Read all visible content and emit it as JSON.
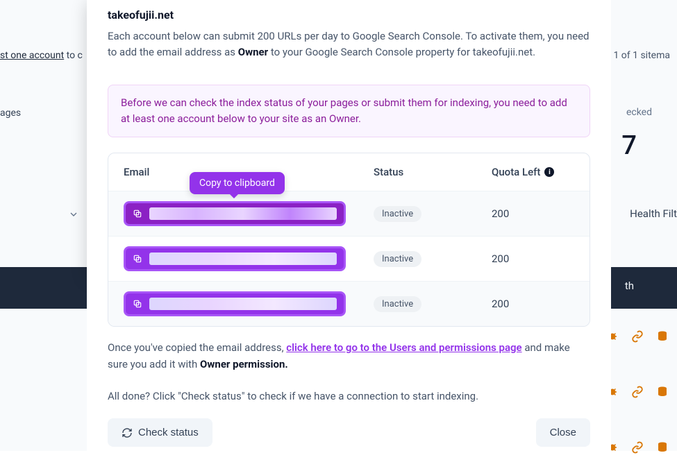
{
  "bg": {
    "left_snippet_link": "st one account",
    "left_snippet_tail": " to c",
    "pages_text": "ages",
    "sitemaps": "1 of 1 sitema",
    "checked_label": "ecked",
    "big_number": "7",
    "health_filter": "Health Filt",
    "th": "th"
  },
  "modal": {
    "title": "takeofujii.net",
    "desc_a": "Each account below can submit 200 URLs per day to Google Search Console. To activate them, you need to add the email address as ",
    "desc_bold": "Owner",
    "desc_b": " to your Google Search Console property for takeofujii.net.",
    "alert": "Before we can check the index status of your pages or submit them for indexing, you need to add at least one account below to your site as an Owner."
  },
  "tooltip": "Copy to clipboard",
  "table": {
    "head_email": "Email",
    "head_status": "Status",
    "head_quota": "Quota Left",
    "rows": [
      {
        "status": "Inactive",
        "quota": "200"
      },
      {
        "status": "Inactive",
        "quota": "200"
      },
      {
        "status": "Inactive",
        "quota": "200"
      }
    ]
  },
  "below": {
    "a": "Once you've copied the email address, ",
    "link": "click here to go to the Users and permissions page",
    "b": " and make sure you add it with ",
    "bold": "Owner permission.",
    "done": "All done? Click \"Check status\" to check if we have a connection to start indexing."
  },
  "actions": {
    "check": "Check status",
    "close": "Close"
  }
}
